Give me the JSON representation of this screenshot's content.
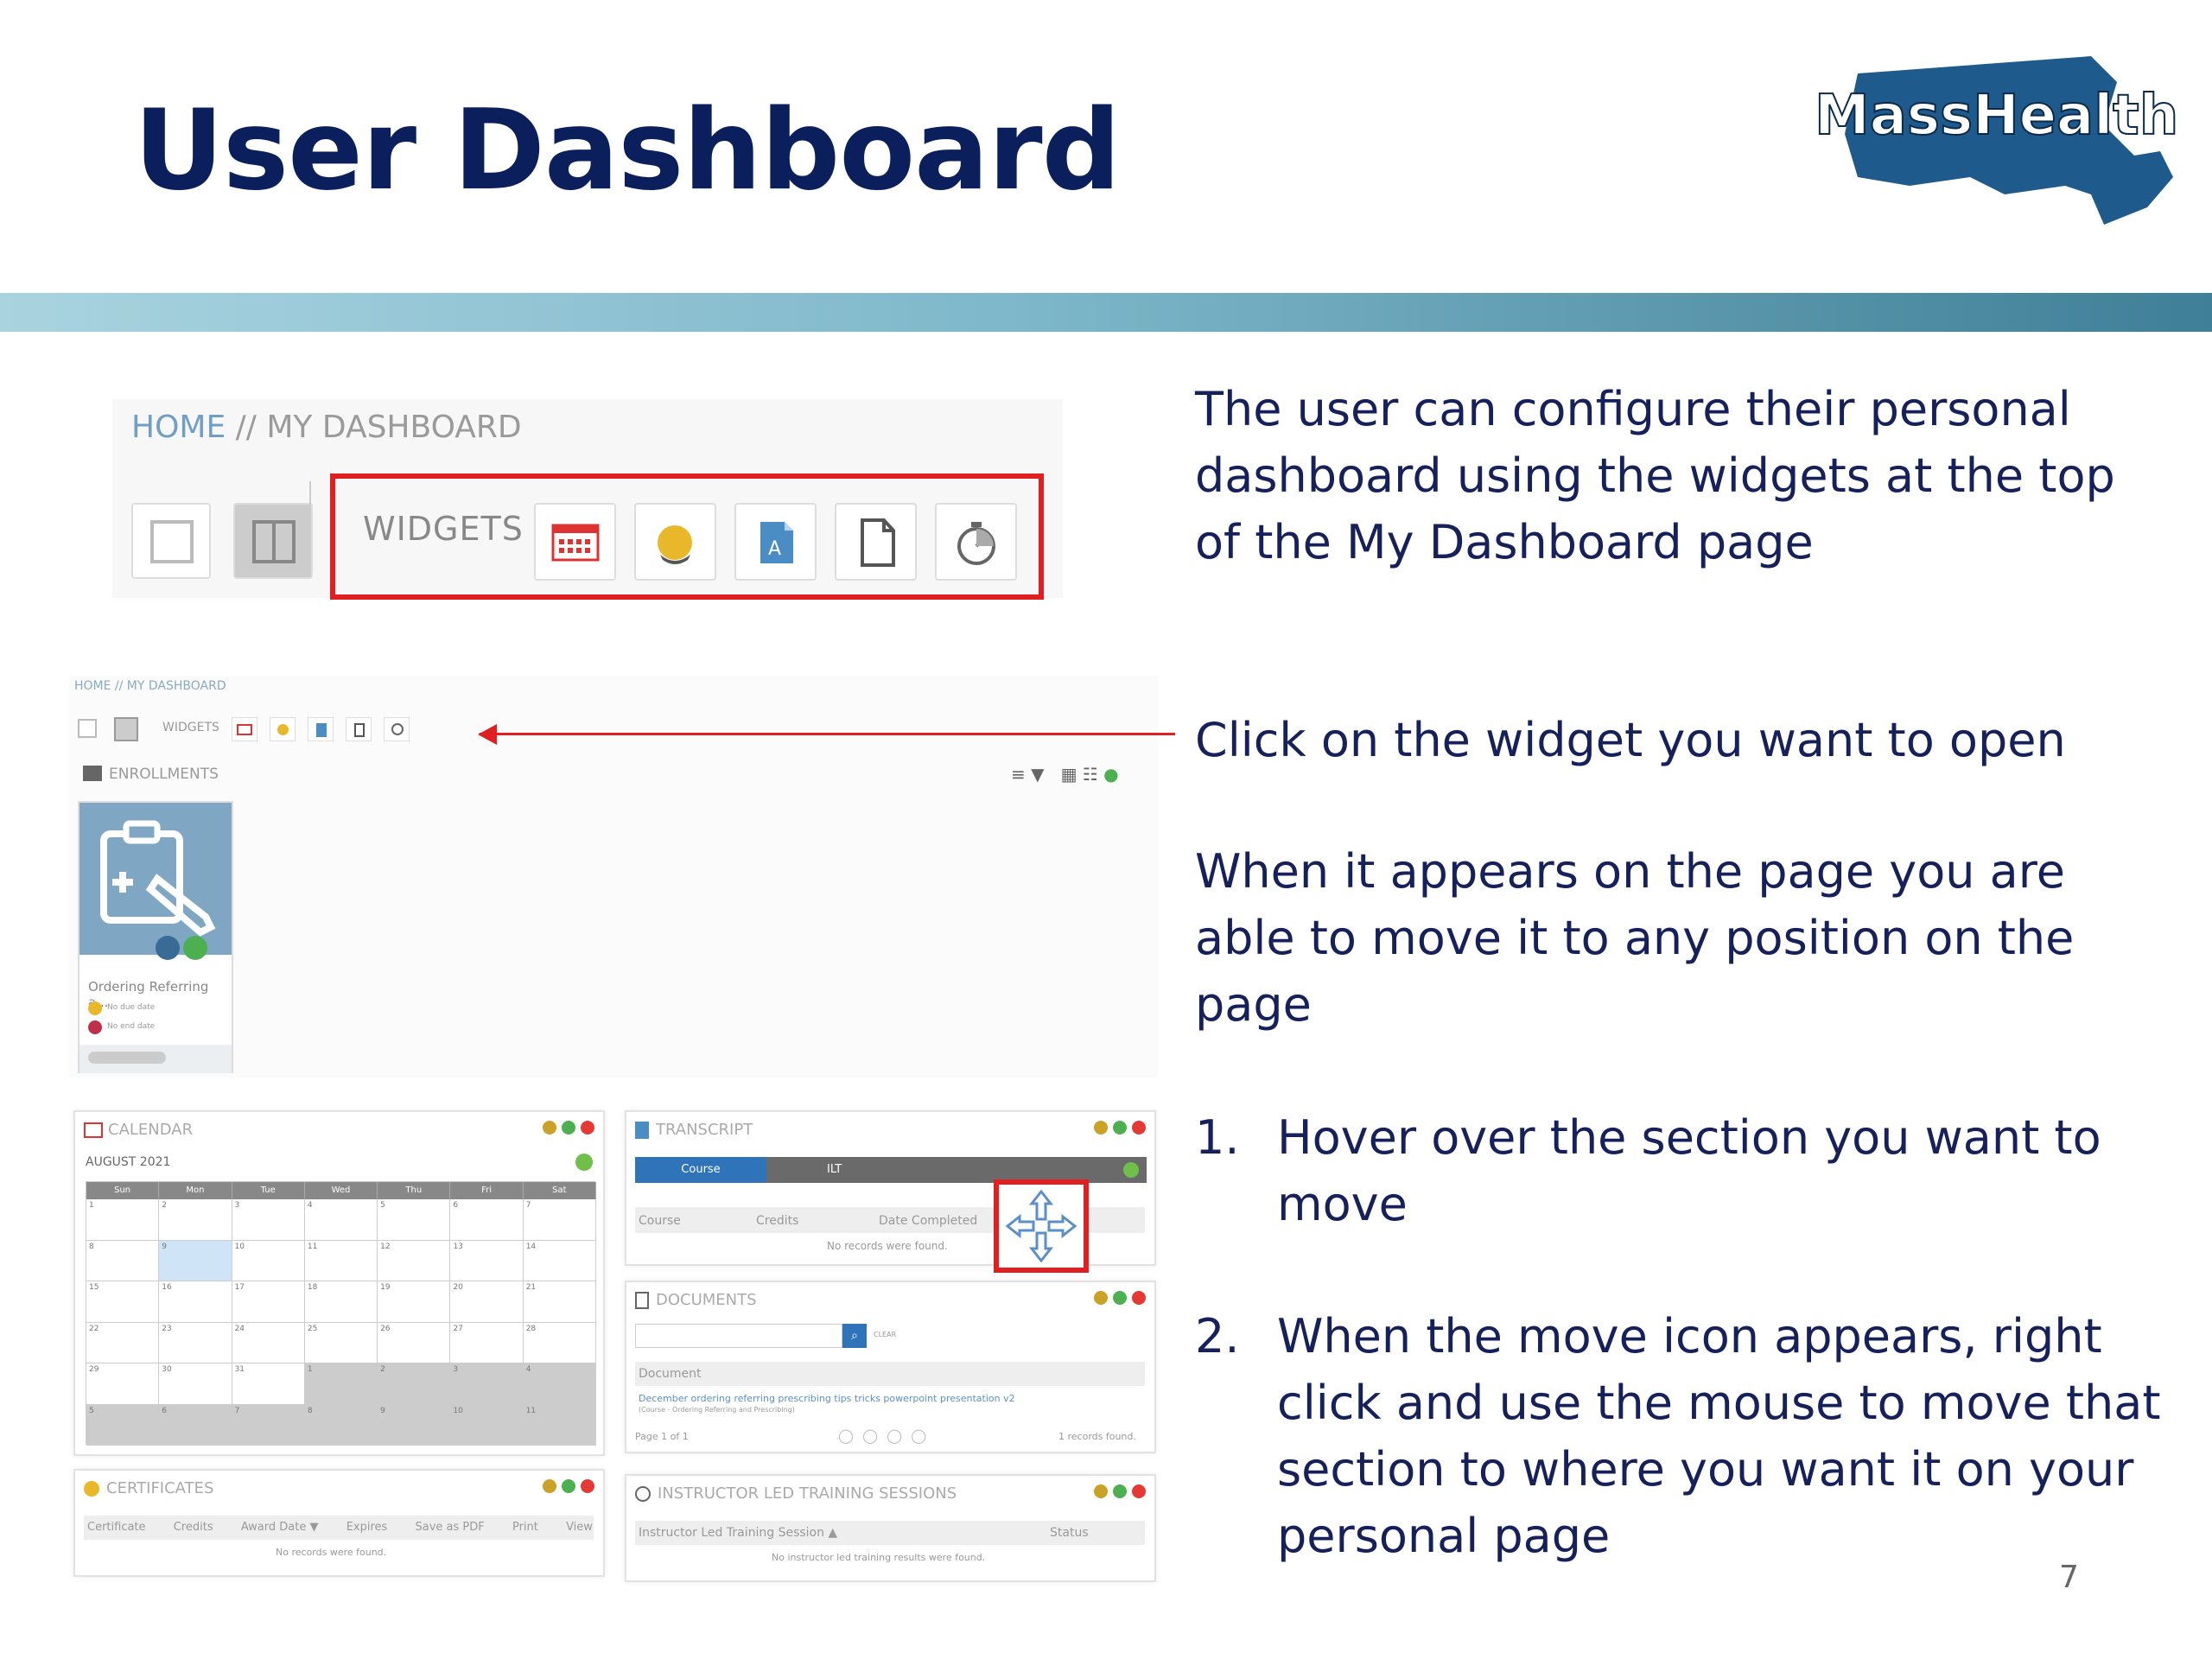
{
  "slide": {
    "title": "User Dashboard",
    "logo_text": "MassHealth",
    "page_number": "7"
  },
  "right_text": {
    "para1_line1": "The user can configure their personal",
    "para1_line2": "dashboard using the widgets at the top",
    "para1_line3": "of the My Dashboard page",
    "para2": "Click on the widget you want to open",
    "para3_line1": "When it appears on the page you are",
    "para3_line2": "able to move it to any position on the",
    "para3_line3": "page",
    "item1_num": "1.",
    "item1_line1": "Hover over the section you want to",
    "item1_line2": "move",
    "item2_num": "2.",
    "item2_line1": "When the move icon appears, right",
    "item2_line2": "click and use the mouse to move that",
    "item2_line3": "section to where you want it on your",
    "item2_line4": "personal page"
  },
  "zoom": {
    "crumb_home": "HOME",
    "crumb_sep": " // ",
    "crumb_page": "MY DASHBOARD",
    "widgets_label": "WIDGETS"
  },
  "mini": {
    "crumb": "HOME // MY DASHBOARD",
    "widgets_label": "WIDGETS",
    "enrollments": "ENROLLMENTS",
    "card_title": "Ordering Referring a...",
    "card_line1": "No due date",
    "card_line2": "No end date"
  },
  "calendar": {
    "title": "CALENDAR",
    "month": "AUGUST 2021",
    "days": [
      "Sun",
      "Mon",
      "Tue",
      "Wed",
      "Thu",
      "Fri",
      "Sat"
    ],
    "rows": [
      [
        "1",
        "2",
        "3",
        "4",
        "5",
        "6",
        "7"
      ],
      [
        "8",
        "9",
        "10",
        "11",
        "12",
        "13",
        "14"
      ],
      [
        "15",
        "16",
        "17",
        "18",
        "19",
        "20",
        "21"
      ],
      [
        "22",
        "23",
        "24",
        "25",
        "26",
        "27",
        "28"
      ],
      [
        "29",
        "30",
        "31",
        "1",
        "2",
        "3",
        "4"
      ],
      [
        "5",
        "6",
        "7",
        "8",
        "9",
        "10",
        "11"
      ]
    ]
  },
  "transcript": {
    "title": "TRANSCRIPT",
    "tab_course": "Course",
    "tab_ilt": "ILT",
    "col_course": "Course",
    "col_credits": "Credits",
    "col_date": "Date Completed",
    "empty": "No records were found."
  },
  "documents": {
    "title": "DOCUMENTS",
    "clear": "CLEAR",
    "col_document": "Document",
    "doc_link": "December ordering referring prescribing tips tricks powerpoint presentation v2",
    "doc_sub": "(Course - Ordering Referring and Prescribing)",
    "page": "Page 1 of 1",
    "records": "1 records found."
  },
  "certificates": {
    "title": "CERTIFICATES",
    "cols": [
      "Certificate",
      "Credits",
      "Award Date ▼",
      "Expires",
      "Save as PDF",
      "Print",
      "View"
    ],
    "empty": "No records were found."
  },
  "ilt": {
    "title": "INSTRUCTOR LED TRAINING SESSIONS",
    "col_session": "Instructor Led Training Session ▲",
    "col_status": "Status",
    "empty": "No instructor led training results were found."
  },
  "colors": {
    "title_navy": "#0b1f5c",
    "text_navy": "#16205a",
    "red_highlight": "#e02020",
    "banner_dark": "#3f7f97",
    "banner_light": "#a9d3df"
  }
}
